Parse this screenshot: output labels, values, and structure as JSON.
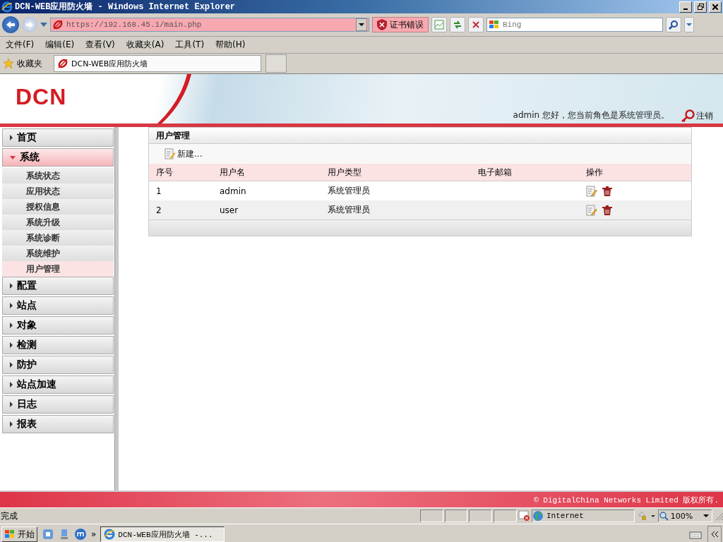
{
  "window": {
    "title": "DCN-WEB应用防火墙 - Windows Internet Explorer"
  },
  "address_bar": {
    "url": "https://192.168.45.1/main.php",
    "cert_error": "证书错误",
    "search_placeholder": "Bing"
  },
  "menu": [
    "文件(F)",
    "编辑(E)",
    "查看(V)",
    "收藏夹(A)",
    "工具(T)",
    "帮助(H)"
  ],
  "favorites": {
    "label": "收藏夹",
    "tab": "DCN-WEB应用防火墙"
  },
  "header": {
    "logo": "DCN",
    "greeting": "admin 您好，您当前角色是系统管理员。",
    "logout": "注销"
  },
  "sidebar": {
    "items": [
      {
        "label": "首页",
        "expanded": false
      },
      {
        "label": "系统",
        "expanded": true,
        "children": [
          {
            "label": "系统状态",
            "selected": false
          },
          {
            "label": "应用状态",
            "selected": false
          },
          {
            "label": "授权信息",
            "selected": false
          },
          {
            "label": "系统升级",
            "selected": false
          },
          {
            "label": "系统诊断",
            "selected": false
          },
          {
            "label": "系统维护",
            "selected": false
          },
          {
            "label": "用户管理",
            "selected": true
          }
        ]
      },
      {
        "label": "配置",
        "expanded": false
      },
      {
        "label": "站点",
        "expanded": false
      },
      {
        "label": "对象",
        "expanded": false
      },
      {
        "label": "检测",
        "expanded": false
      },
      {
        "label": "防护",
        "expanded": false
      },
      {
        "label": "站点加速",
        "expanded": false
      },
      {
        "label": "日志",
        "expanded": false
      },
      {
        "label": "报表",
        "expanded": false
      }
    ]
  },
  "panel": {
    "title": "用户管理",
    "new_button": "新建...",
    "table": {
      "columns": [
        "序号",
        "用户名",
        "用户类型",
        "电子邮箱",
        "操作"
      ],
      "rows": [
        [
          "1",
          "admin",
          "系统管理员",
          ""
        ],
        [
          "2",
          "user",
          "系统管理员",
          ""
        ]
      ]
    }
  },
  "footer": {
    "copyright": "© DigitalChina Networks Limited 版权所有."
  },
  "status_bar": {
    "text": "完成",
    "zone": "Internet",
    "zoom": "100%"
  },
  "taskbar": {
    "start": "开始",
    "more": "»",
    "task": "DCN-WEB应用防火墙 -..."
  }
}
